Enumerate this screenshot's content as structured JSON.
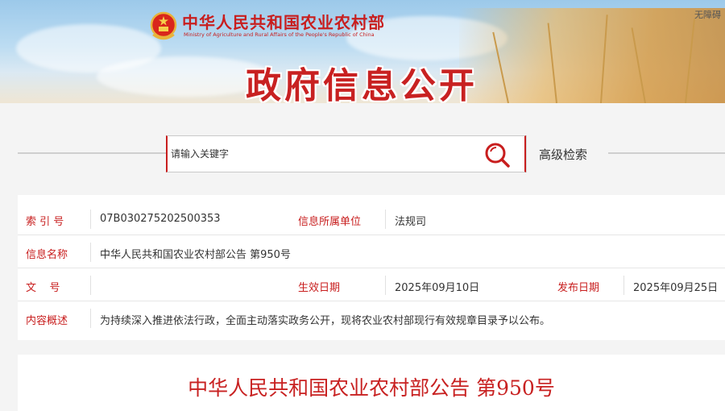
{
  "header": {
    "ministry_cn": "中华人民共和国农业农村部",
    "ministry_en": "Ministry of Agriculture and Rural Affairs of the People's Republic of China",
    "accessibility": "无障碍",
    "banner_title": "政府信息公开"
  },
  "search": {
    "placeholder": "请输入关键字",
    "advanced_label": "高级检索"
  },
  "info": {
    "index_label": "索 引 号",
    "index_value": "07B030275202500353",
    "org_label": "信息所属单位",
    "org_value": "法规司",
    "name_label": "信息名称",
    "name_value": "中华人民共和国农业农村部公告 第950号",
    "doc_no_label": "文    号",
    "doc_no_value": "",
    "effective_label": "生效日期",
    "effective_value": "2025年09月10日",
    "publish_label": "发布日期",
    "publish_value": "2025年09月25日",
    "summary_label": "内容概述",
    "summary_value": "为持续深入推进依法行政，全面主动落实政务公开，现将农业农村部现行有效规章目录予以公布。"
  },
  "notice": {
    "title": "中华人民共和国农业农村部公告 第950号"
  },
  "colors": {
    "brand_red": "#c81e1e",
    "background": "#f4f4f4"
  }
}
